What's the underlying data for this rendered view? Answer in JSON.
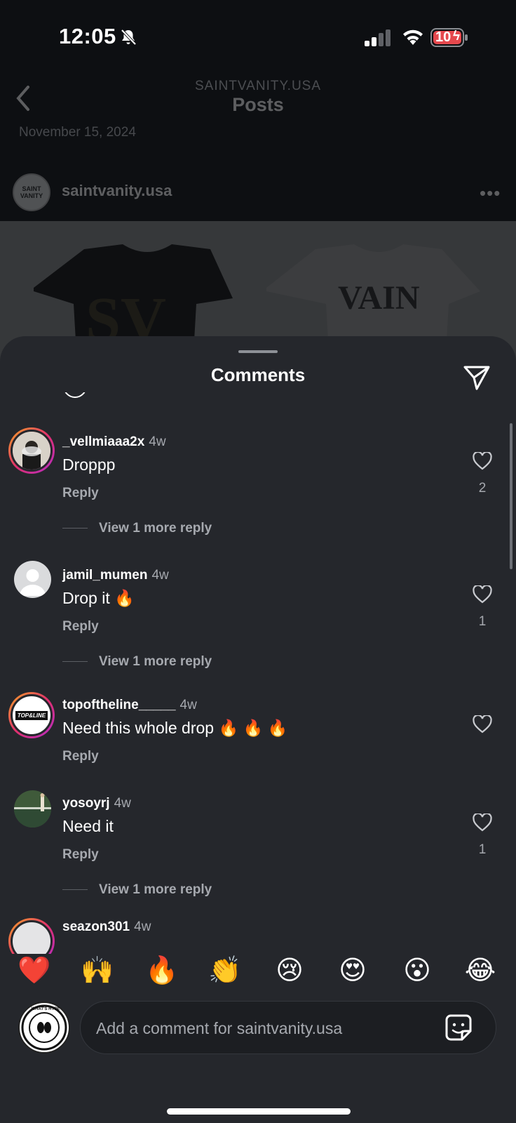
{
  "status_bar": {
    "time": "12:05",
    "battery": "10"
  },
  "nav": {
    "subtitle": "SAINTVANITY.USA",
    "title": "Posts"
  },
  "post": {
    "date": "November 15, 2024",
    "username": "saintvanity.usa",
    "avatar_text": "SAINT VANITY"
  },
  "sheet": {
    "title": "Comments"
  },
  "comments": [
    {
      "username": "_vellmiaaa2x",
      "time": "4w",
      "text": "Droppp",
      "reply": "Reply",
      "likes": "2",
      "more_replies": "View 1 more reply"
    },
    {
      "username": "jamil_mumen",
      "time": "4w",
      "text": "Drop it 🔥",
      "reply": "Reply",
      "likes": "1",
      "more_replies": "View 1 more reply"
    },
    {
      "username": "topoftheline_____",
      "time": "4w",
      "text": "Need this whole drop 🔥 🔥 🔥",
      "reply": "Reply",
      "likes": "",
      "more_replies": "",
      "avatar_text": "TOP&LINE"
    },
    {
      "username": "yosoyrj",
      "time": "4w",
      "text": "Need it",
      "reply": "Reply",
      "likes": "1",
      "more_replies": "View 1 more reply"
    },
    {
      "username": "seazon301",
      "time": "4w"
    }
  ],
  "quick_reactions": [
    "❤️",
    "🙌",
    "🔥",
    "👏",
    "😢",
    "😍",
    "😮",
    "😂"
  ],
  "composer": {
    "placeholder": "Add a comment for saintvanity.usa",
    "avatar_text": "WHAT'S HYPE"
  },
  "colors": {
    "sheet_bg": "#25272c",
    "muted_text": "#a6a9af",
    "story_ring_start": "#f6a623",
    "story_ring_end": "#b32cc8"
  }
}
